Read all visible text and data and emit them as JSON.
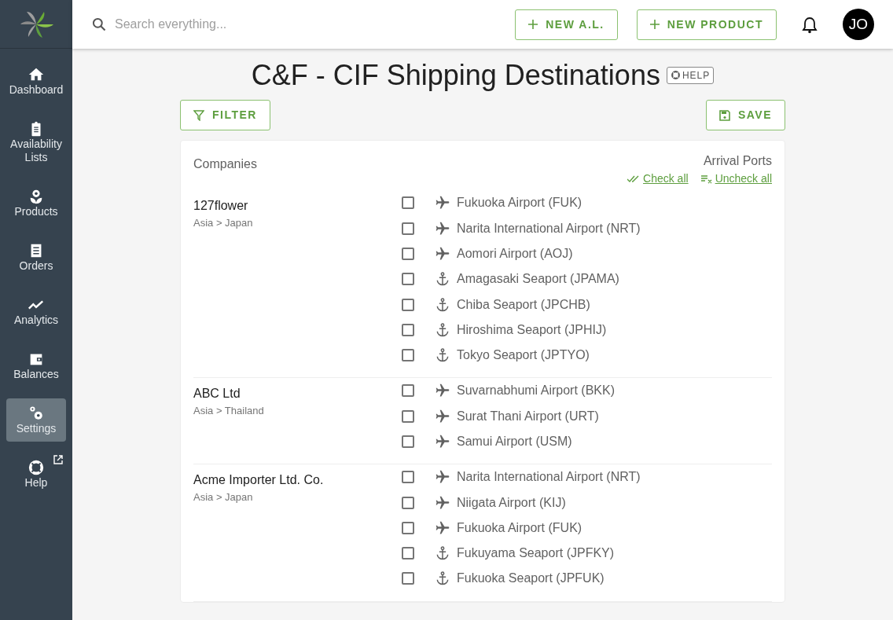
{
  "topbar": {
    "search": {
      "placeholder": "Search everything..."
    },
    "buttons": [
      {
        "label": "NEW A.L."
      },
      {
        "label": "NEW PRODUCT"
      }
    ],
    "avatar": "JO"
  },
  "sidebar": {
    "items": [
      {
        "label": "Dashboard",
        "kind": "home",
        "selected": false
      },
      {
        "label": "Availability Lists",
        "kind": "clipboard",
        "selected": false
      },
      {
        "label": "Products",
        "kind": "flower",
        "selected": false
      },
      {
        "label": "Orders",
        "kind": "receipt",
        "selected": false
      },
      {
        "label": "Analytics",
        "kind": "chart",
        "selected": false
      },
      {
        "label": "Balances",
        "kind": "wallet",
        "selected": false
      },
      {
        "label": "Settings",
        "kind": "gears",
        "selected": true
      },
      {
        "label": "Help",
        "kind": "lifebuoy",
        "selected": false,
        "external": true
      }
    ]
  },
  "page": {
    "title": "C&F - CIF Shipping Destinations",
    "help": "HELP",
    "filter": "FILTER",
    "save": "SAVE"
  },
  "table": {
    "companies_heading": "Companies",
    "ports_heading": "Arrival Ports",
    "check_all": "Check all",
    "uncheck_all": "Uncheck all",
    "rows": [
      {
        "company": "127flower",
        "region": "Asia > Japan",
        "ports": [
          {
            "kind": "airport",
            "name": "Fukuoka Airport (FUK)",
            "checked": false
          },
          {
            "kind": "airport",
            "name": "Narita International Airport (NRT)",
            "checked": false
          },
          {
            "kind": "airport",
            "name": "Aomori Airport (AOJ)",
            "checked": false
          },
          {
            "kind": "seaport",
            "name": "Amagasaki Seaport (JPAMA)",
            "checked": false
          },
          {
            "kind": "seaport",
            "name": "Chiba Seaport (JPCHB)",
            "checked": false
          },
          {
            "kind": "seaport",
            "name": "Hiroshima Seaport (JPHIJ)",
            "checked": false
          },
          {
            "kind": "seaport",
            "name": "Tokyo Seaport (JPTYO)",
            "checked": false
          }
        ]
      },
      {
        "company": "ABC Ltd",
        "region": "Asia > Thailand",
        "ports": [
          {
            "kind": "airport",
            "name": "Suvarnabhumi Airport (BKK)",
            "checked": false
          },
          {
            "kind": "airport",
            "name": "Surat Thani Airport (URT)",
            "checked": false
          },
          {
            "kind": "airport",
            "name": "Samui Airport (USM)",
            "checked": false
          }
        ]
      },
      {
        "company": "Acme Importer Ltd. Co.",
        "region": "Asia > Japan",
        "ports": [
          {
            "kind": "airport",
            "name": "Narita International Airport (NRT)",
            "checked": false
          },
          {
            "kind": "airport",
            "name": "Niigata Airport (KIJ)",
            "checked": false
          },
          {
            "kind": "airport",
            "name": "Fukuoka Airport (FUK)",
            "checked": false
          },
          {
            "kind": "seaport",
            "name": "Fukuyama Seaport (JPFKY)",
            "checked": false
          },
          {
            "kind": "seaport",
            "name": "Fukuoka Seaport (JPFUK)",
            "checked": false
          }
        ]
      }
    ]
  }
}
